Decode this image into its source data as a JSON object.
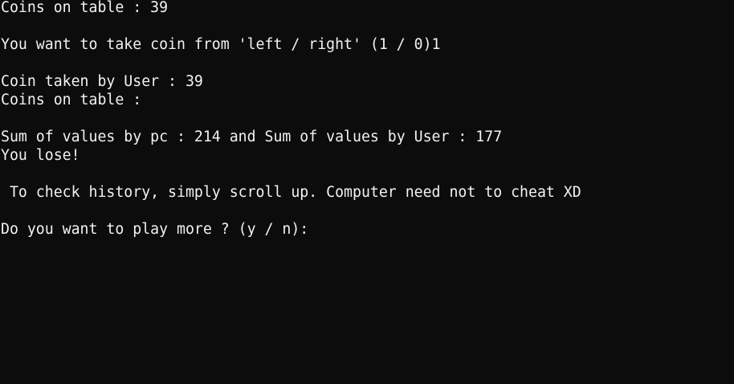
{
  "console": {
    "lines": [
      "Coins on table : 39",
      "",
      "You want to take coin from 'left / right' (1 / 0)1",
      "",
      "Coin taken by User : 39",
      "Coins on table :",
      "",
      "Sum of values by pc : 214 and Sum of values by User : 177",
      "You lose!",
      "",
      " To check history, simply scroll up. Computer need not to cheat XD",
      "",
      "Do you want to play more ? (y / n):"
    ]
  },
  "colors": {
    "background": "#0c0c0c",
    "text": "#f2f2f2"
  }
}
